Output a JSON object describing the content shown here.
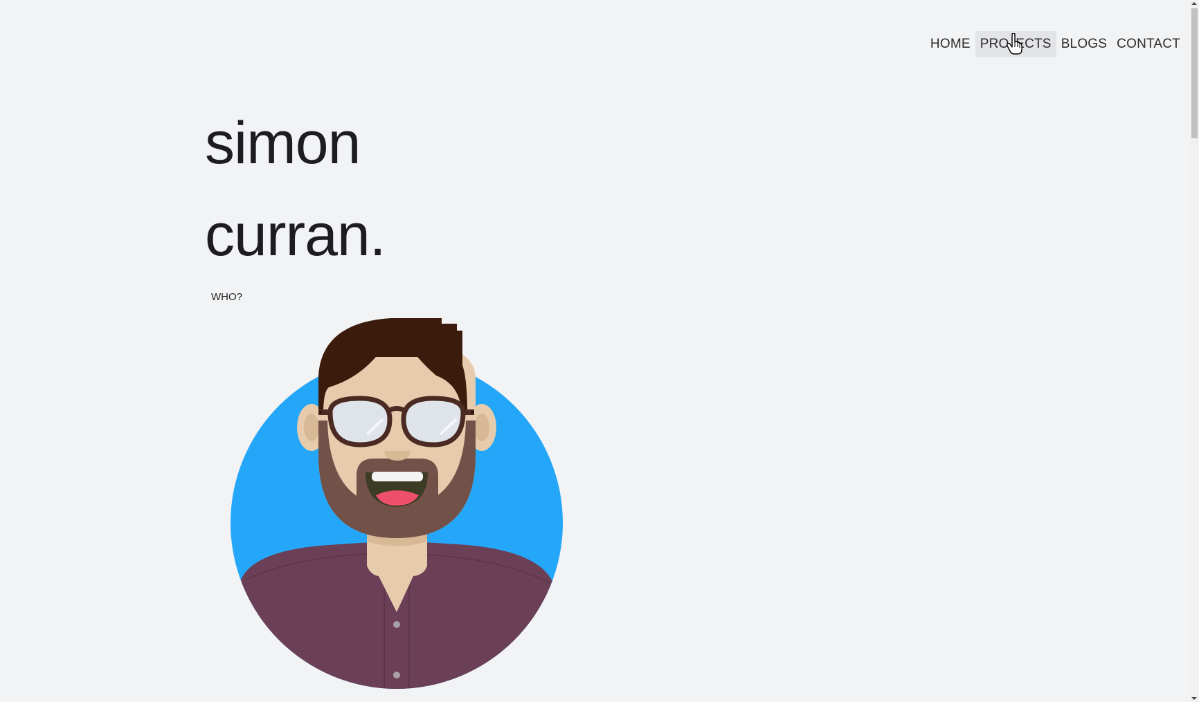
{
  "nav": {
    "items": [
      {
        "label": "HOME"
      },
      {
        "label": "PROJECTS"
      },
      {
        "label": "BLOGS"
      },
      {
        "label": "CONTACT"
      }
    ]
  },
  "hero": {
    "first_name": "simon",
    "last_name": "curran.",
    "who_label": "WHO?"
  },
  "avatar": {
    "icon": "avatar-illustration",
    "colors": {
      "background_circle": "#25a7f9",
      "hair": "#3b1c0c",
      "skin": "#e6cbad",
      "beard": "#725149",
      "shirt": "#6b3f55",
      "glasses_frame": "#4a2a22",
      "tongue": "#ee4f6a"
    }
  }
}
